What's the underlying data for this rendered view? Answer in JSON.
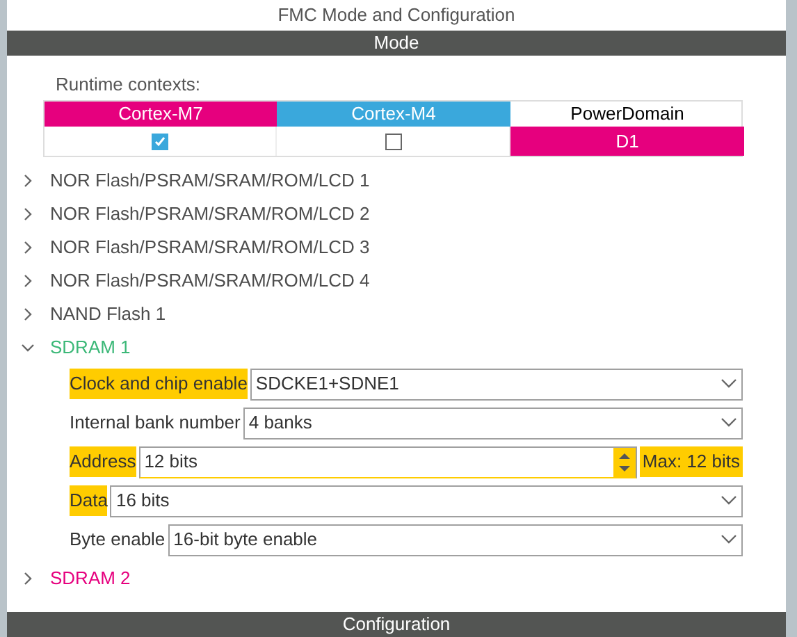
{
  "title": "FMC Mode and Configuration",
  "mode_bar": "Mode",
  "runtime": {
    "label": "Runtime contexts:",
    "contexts": [
      {
        "label": "Cortex-M7",
        "color": "#e6007e",
        "checked": true
      },
      {
        "label": "Cortex-M4",
        "color": "#3aa8dc",
        "checked": false
      }
    ],
    "power_domain": {
      "label": "PowerDomain",
      "value": "D1"
    }
  },
  "tree": [
    {
      "label": "NOR Flash/PSRAM/SRAM/ROM/LCD 1",
      "expanded": false,
      "color": "#4d4d4d"
    },
    {
      "label": "NOR Flash/PSRAM/SRAM/ROM/LCD 2",
      "expanded": false,
      "color": "#4d4d4d"
    },
    {
      "label": "NOR Flash/PSRAM/SRAM/ROM/LCD 3",
      "expanded": false,
      "color": "#4d4d4d"
    },
    {
      "label": "NOR Flash/PSRAM/SRAM/ROM/LCD 4",
      "expanded": false,
      "color": "#4d4d4d"
    },
    {
      "label": "NAND Flash 1",
      "expanded": false,
      "color": "#4d4d4d"
    },
    {
      "label": "SDRAM 1",
      "expanded": true,
      "color": "#3cb878",
      "fields": [
        {
          "kind": "select",
          "label": "Clock and chip enable",
          "highlighted": true,
          "value": "SDCKE1+SDNE1"
        },
        {
          "kind": "select",
          "label": "Internal bank number",
          "highlighted": false,
          "value": "4 banks"
        },
        {
          "kind": "spinner",
          "label": "Address",
          "highlighted": true,
          "value": "12 bits",
          "note": "Max: 12 bits"
        },
        {
          "kind": "select",
          "label": "Data",
          "highlighted": true,
          "value": "16 bits"
        },
        {
          "kind": "select",
          "label": "Byte enable",
          "highlighted": false,
          "value": "16-bit byte enable"
        }
      ]
    },
    {
      "label": "SDRAM 2",
      "expanded": false,
      "color": "#e6007e"
    }
  ],
  "config_bar": "Configuration"
}
